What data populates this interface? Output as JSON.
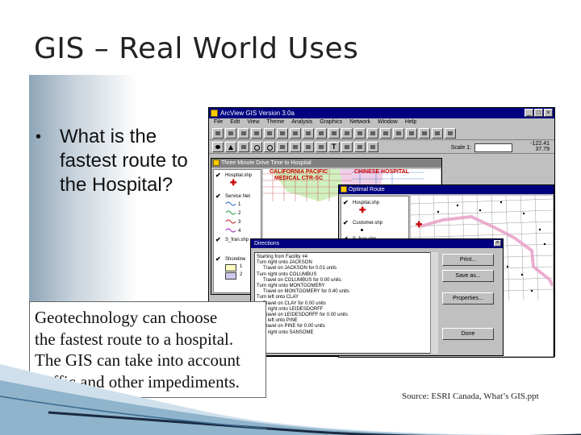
{
  "slide": {
    "title": "GIS – Real World Uses",
    "bullet": "•",
    "bullet_lines": [
      "What is the",
      "fastest route to",
      "the Hospital?"
    ],
    "caption_lines": [
      "Geotechnology can choose",
      "the fastest route to a hospital.",
      "The GIS can take into account",
      "traffic and other impediments."
    ],
    "source": "Source: ESRI Canada, What’s GIS.ppt"
  },
  "arcview": {
    "title": "ArcView GIS Version 3.0a",
    "menu": [
      "File",
      "Edit",
      "View",
      "Theme",
      "Analysis",
      "Graphics",
      "Network",
      "Window",
      "Help"
    ],
    "scale_label": "Scale 1:",
    "coords": [
      "-122.41",
      "37.79"
    ],
    "controls": {
      "minimize": "_",
      "maximize": "□",
      "close": "×"
    }
  },
  "drive_window": {
    "title": "Three Minute Drive Time to Hospital",
    "toc": [
      "Hospital.shp",
      "Service Net",
      "1",
      "2",
      "3",
      "4",
      "S_fran.shp",
      "Shoreline",
      "1",
      "2"
    ],
    "labels": [
      "CALIFORNIA PACIFIC",
      "MEDICAL CTR-SC",
      "CHINESE HOSPITAL"
    ]
  },
  "route_window": {
    "title": "Optimal Route",
    "toc": [
      "Hospital.shp",
      "Customer.shp",
      "S_fran.shp"
    ]
  },
  "directions": {
    "title": "Directions",
    "steps": [
      "Starting from Facility #4",
      "Turn right onto JACKSON",
      "Travel on JACKSON for 0.01 units",
      "Turn right onto COLUMBUS",
      "Travel on COLUMBUS for 0.00 units",
      "Turn right onto MONTGOMERY",
      "Travel on MONTGOMERY for 0.40 units",
      "Turn left onto CLAY",
      "Travel on CLAY for 0.00 units",
      "Turn right onto LEIDESDORFF",
      "Travel on LEIDESDORFF for 0.00 units",
      "Turn left onto PINE",
      "Travel on PINE for 0.00 units",
      "Turn right onto SANSOME"
    ],
    "buttons": {
      "print": "Print...",
      "save": "Save as...",
      "properties": "Properties...",
      "done": "Done"
    },
    "close": "×"
  },
  "colors": {
    "titlebar": "#000080",
    "route": "#e8a0c8",
    "hospital": "#cc0000",
    "window_bg": "#c0c0c0"
  }
}
